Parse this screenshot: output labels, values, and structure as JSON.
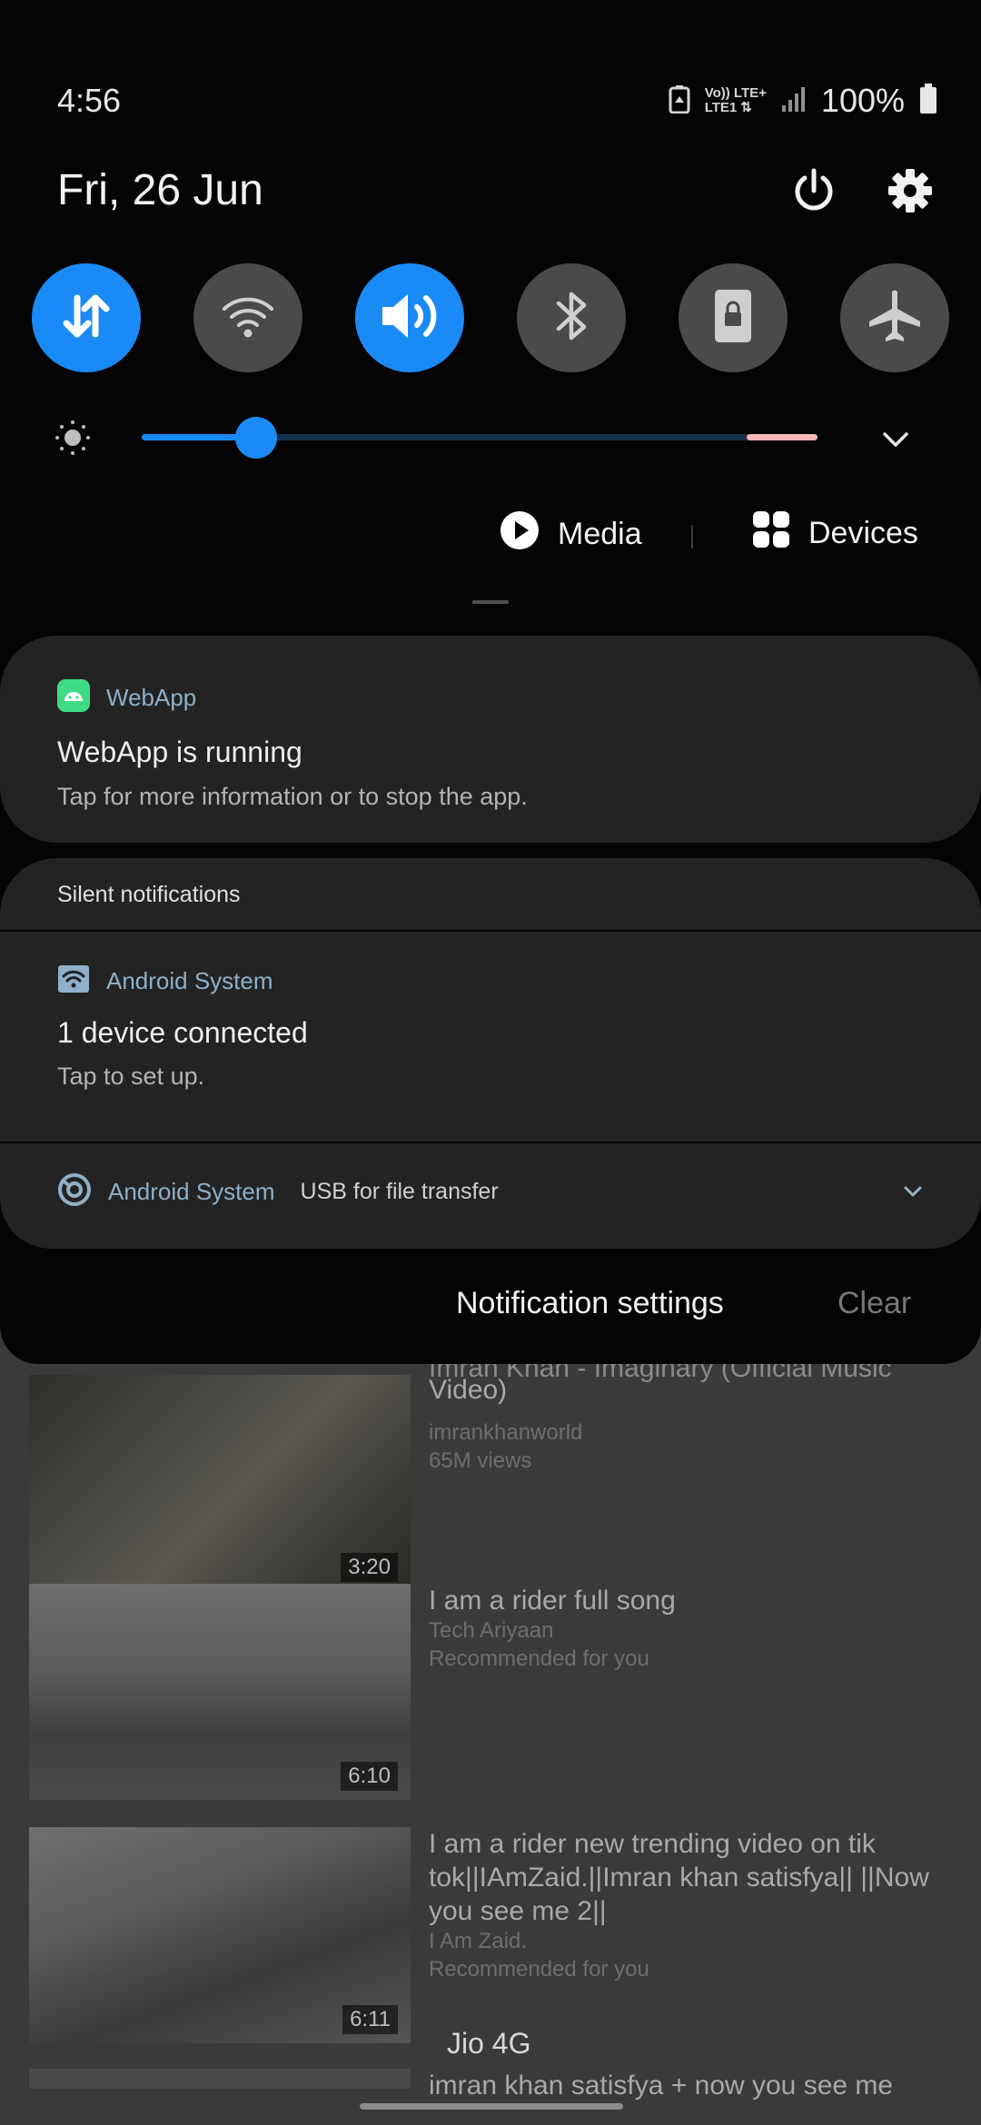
{
  "status_bar": {
    "time": "4:56",
    "network_top": "Vo)) LTE+",
    "network_bottom": "LTE1",
    "battery_percent": "100%",
    "icons": [
      "data-saver-icon",
      "volte-lte-icon",
      "signal-icon",
      "battery-icon"
    ]
  },
  "header": {
    "date": "Fri, 26 Jun",
    "power_icon": "power-icon",
    "settings_icon": "gear-icon"
  },
  "quick_settings": [
    {
      "name": "mobile-data",
      "icon": "data-arrows-icon",
      "state": "on"
    },
    {
      "name": "wifi",
      "icon": "wifi-icon",
      "state": "off"
    },
    {
      "name": "sound",
      "icon": "speaker-icon",
      "state": "on"
    },
    {
      "name": "bluetooth",
      "icon": "bluetooth-icon",
      "state": "off"
    },
    {
      "name": "auto-rotate",
      "icon": "lock-rotation-icon",
      "state": "off"
    },
    {
      "name": "airplane-mode",
      "icon": "airplane-icon",
      "state": "off"
    }
  ],
  "brightness": {
    "level": 0.17
  },
  "media_bar": {
    "media_label": "Media",
    "devices_label": "Devices"
  },
  "notifications": {
    "webapp": {
      "app_name": "WebApp",
      "title": "WebApp is running",
      "body": "Tap for more information or to stop the app."
    },
    "silent_header": "Silent notifications",
    "android_device": {
      "app_name": "Android System",
      "title": "1 device connected",
      "body": "Tap to set up."
    },
    "android_usb": {
      "app_name": "Android System",
      "summary": "USB for file transfer"
    }
  },
  "actions": {
    "settings_label": "Notification settings",
    "clear_label": "Clear"
  },
  "background_app": {
    "videos": [
      {
        "title_top": "Imran Khan - Imaginary (Official Music",
        "title": "Video)",
        "channel": "imrankhanworld",
        "meta": "65M views",
        "duration": "3:20"
      },
      {
        "title": "I am a rider full song",
        "channel": "Tech Ariyaan",
        "meta": "Recommended for you",
        "duration": "6:10"
      },
      {
        "title": "I am a rider new trending video on tik tok||IAmZaid.||Imran khan satisfya|| ||Now you see me 2||",
        "channel": "I Am Zaid.",
        "meta": "Recommended for you",
        "duration": "6:11"
      },
      {
        "title": "imran khan satisfya + now you see me"
      }
    ],
    "carrier": "Jio 4G"
  },
  "colors": {
    "accent": "#1a8bf6",
    "card": "#232323",
    "shade": "#040404"
  }
}
